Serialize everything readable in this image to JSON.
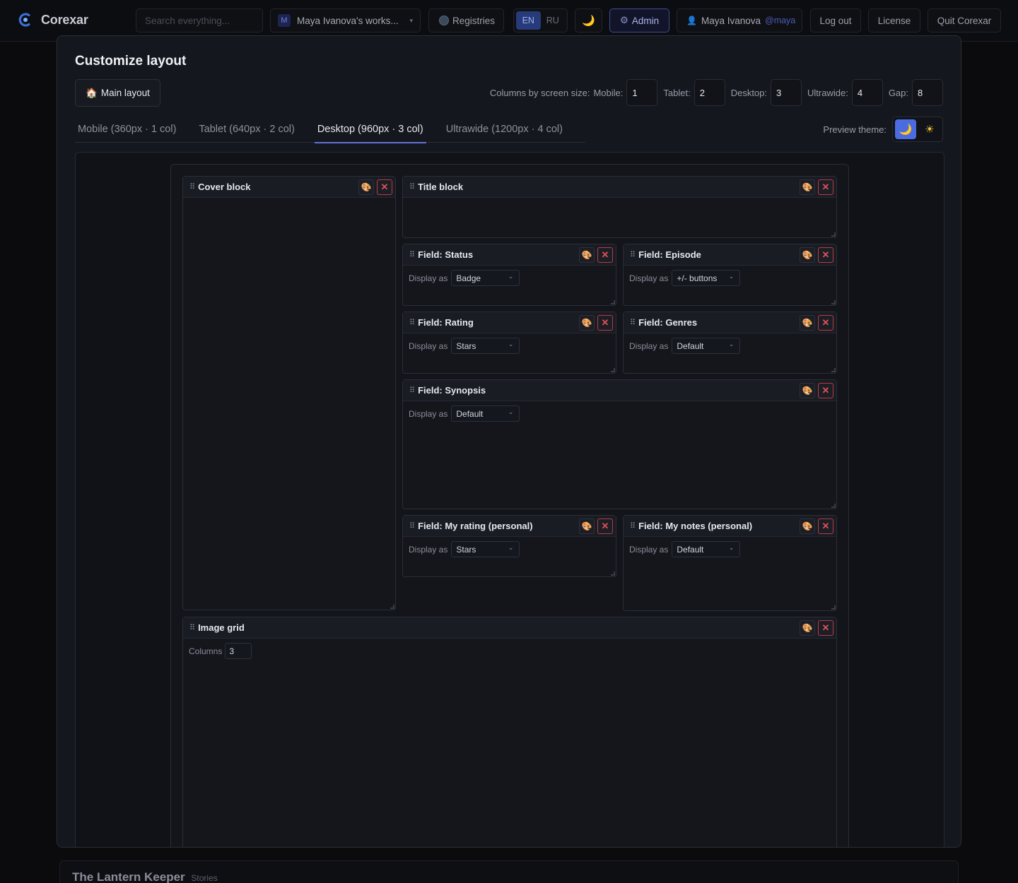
{
  "app": {
    "name": "Corexar"
  },
  "topbar": {
    "search_placeholder": "Search everything...",
    "workspace": {
      "badge": "M",
      "label": "Maya Ivanova's works..."
    },
    "registries_label": "Registries",
    "languages": [
      "EN",
      "RU"
    ],
    "active_language": "EN",
    "theme_icon": "moon-icon",
    "admin_label": "Admin",
    "user": {
      "name": "Maya Ivanova",
      "handle": "@maya"
    },
    "logout_label": "Log out",
    "license_label": "License",
    "quit_label": "Quit Corexar"
  },
  "modal": {
    "title": "Customize layout",
    "layout_button": "Main layout",
    "columns_label": "Columns by screen size:",
    "columns": [
      {
        "label": "Mobile:",
        "value": "1"
      },
      {
        "label": "Tablet:",
        "value": "2"
      },
      {
        "label": "Desktop:",
        "value": "3"
      },
      {
        "label": "Ultrawide:",
        "value": "4"
      },
      {
        "label": "Gap:",
        "value": "8"
      }
    ],
    "tabs": [
      "Mobile (360px · 1 col)",
      "Tablet (640px · 2 col)",
      "Desktop (960px · 3 col)",
      "Ultrawide (1200px · 4 col)"
    ],
    "active_tab": "Desktop (960px · 3 col)",
    "preview_theme_label": "Preview theme:",
    "preview_theme_active": "dark"
  },
  "blocks": {
    "cover": {
      "title": "Cover block"
    },
    "title": {
      "title": "Title block"
    },
    "status": {
      "title": "Field: Status",
      "display_label": "Display as",
      "display_value": "Badge"
    },
    "episode": {
      "title": "Field: Episode",
      "display_label": "Display as",
      "display_value": "+/- buttons"
    },
    "rating": {
      "title": "Field: Rating",
      "display_label": "Display as",
      "display_value": "Stars"
    },
    "genres": {
      "title": "Field: Genres",
      "display_label": "Display as",
      "display_value": "Default"
    },
    "synopsis": {
      "title": "Field: Synopsis",
      "display_label": "Display as",
      "display_value": "Default"
    },
    "my_rating": {
      "title": "Field: My rating (personal)",
      "display_label": "Display as",
      "display_value": "Stars"
    },
    "my_notes": {
      "title": "Field: My notes (personal)",
      "display_label": "Display as",
      "display_value": "Default"
    },
    "image_grid": {
      "title": "Image grid",
      "columns_label": "Columns",
      "columns_value": "3"
    }
  },
  "background_card": {
    "title": "The Lantern Keeper",
    "subtitle": "Stories"
  },
  "colors": {
    "accent": "#6473d6",
    "danger": "#e05058",
    "style_icon": "#e8b640"
  }
}
